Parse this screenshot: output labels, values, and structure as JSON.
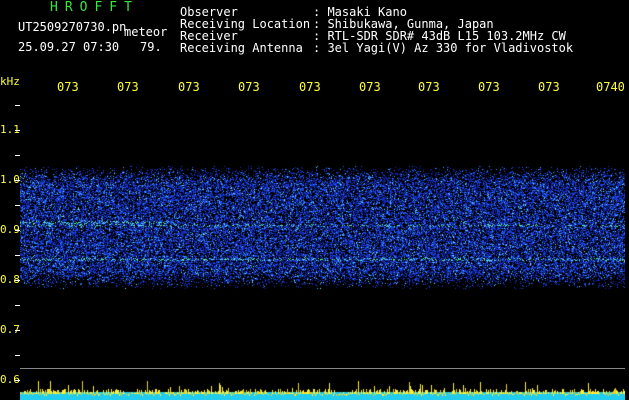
{
  "header": {
    "app_name": "HROFFT",
    "filename": "UT2509270730.pn",
    "mode": "meteor",
    "datetime": "25.09.27 07:30",
    "count": "79.",
    "fields": [
      {
        "label": "Observer",
        "value": ": Masaki Kano"
      },
      {
        "label": "Receiving Location",
        "value": ": Shibukawa, Gunma, Japan"
      },
      {
        "label": "Receiver",
        "value": ": RTL-SDR SDR# 43dB L15 103.2MHz CW"
      },
      {
        "label": "Receiving Antenna",
        "value": ": 3el Yagi(V) Az 330 for Vladivostok"
      }
    ]
  },
  "axis": {
    "unit": "kHz",
    "time_ticks": [
      "073",
      "073",
      "073",
      "073",
      "073",
      "073",
      "073",
      "073",
      "073",
      "0740"
    ],
    "freq_ticks": [
      "1.1",
      "1.0",
      "0.9",
      "0.8",
      "0.7",
      "0.6"
    ]
  },
  "colors": {
    "background": "#000000",
    "title_green": "#39e639",
    "label_yellow": "#ffff33",
    "noise_blue": "#1a2fd8",
    "noise_bright": "#3ea0ff",
    "signal_green": "#55ff99",
    "bars_cyan": "#33ddff",
    "bars_yellow": "#ffee33"
  }
}
